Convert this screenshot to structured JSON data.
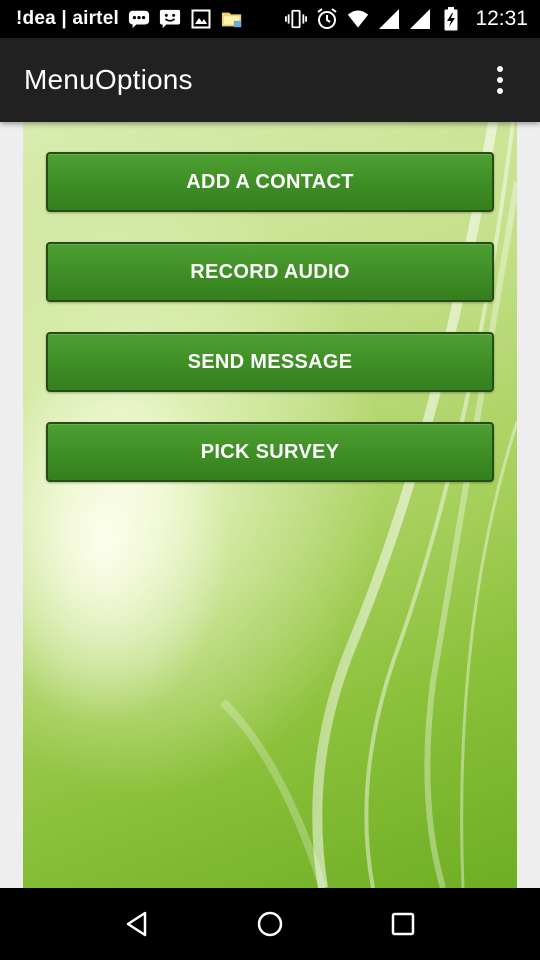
{
  "status_bar": {
    "carrier": "!dea | airtel",
    "time": "12:31",
    "icons": [
      "chat-bubble-icon",
      "face-message-icon",
      "image-icon",
      "folder-icon",
      "vibrate-icon",
      "alarm-icon",
      "wifi-icon",
      "signal-icon",
      "signal-icon-2",
      "battery-charging-icon"
    ]
  },
  "app_bar": {
    "title": "MenuOptions",
    "overflow_icon": "more-vert-icon"
  },
  "menu": {
    "buttons": [
      {
        "label": "ADD A CONTACT"
      },
      {
        "label": "RECORD AUDIO"
      },
      {
        "label": "SEND MESSAGE"
      },
      {
        "label": "PICK SURVEY"
      }
    ]
  },
  "nav_bar": {
    "icons": [
      "back-icon",
      "home-icon",
      "recents-icon"
    ]
  },
  "colors": {
    "app_bar": "#212121",
    "button_green": "#3f8f26",
    "button_border": "#244d15",
    "background_green": "#8cc13b"
  }
}
